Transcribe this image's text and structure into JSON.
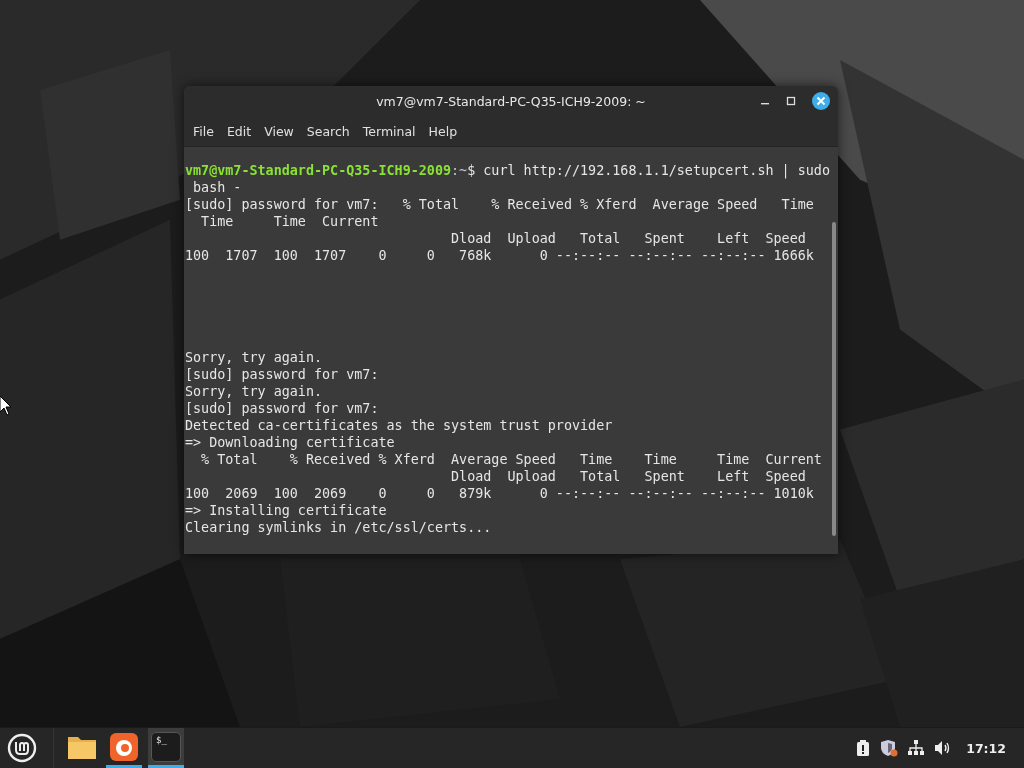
{
  "window": {
    "title": "vm7@vm7-Standard-PC-Q35-ICH9-2009: ~",
    "menu": [
      "File",
      "Edit",
      "View",
      "Search",
      "Terminal",
      "Help"
    ]
  },
  "terminal": {
    "blocks": [
      [
        {
          "kind": "prompt",
          "user_host": "vm7@vm7-Standard-PC-Q35-ICH9-2009",
          "path": ":~",
          "text": "$ curl http://192.168.1.1/setupcert.sh | sudo"
        },
        {
          "kind": "output",
          "text": " bash -"
        },
        {
          "kind": "output",
          "text": "[sudo] password for vm7:   % Total    % Received % Xferd  Average Speed   Time"
        },
        {
          "kind": "output",
          "text": "  Time     Time  Current"
        },
        {
          "kind": "output",
          "text": "                                 Dload  Upload   Total   Spent    Left  Speed"
        },
        {
          "kind": "output",
          "text": "100  1707  100  1707    0     0   768k      0 --:--:-- --:--:-- --:--:-- 1666k"
        }
      ],
      [
        {
          "kind": "output",
          "text": "Sorry, try again."
        },
        {
          "kind": "output",
          "text": "[sudo] password for vm7:"
        },
        {
          "kind": "output",
          "text": "Sorry, try again."
        },
        {
          "kind": "output",
          "text": "[sudo] password for vm7:"
        },
        {
          "kind": "output",
          "text": "Detected ca-certificates as the system trust provider"
        },
        {
          "kind": "output",
          "text": "=> Downloading certificate"
        },
        {
          "kind": "output",
          "text": "  % Total    % Received % Xferd  Average Speed   Time    Time     Time  Current"
        },
        {
          "kind": "output",
          "text": "                                 Dload  Upload   Total   Spent    Left  Speed"
        },
        {
          "kind": "output",
          "text": "100  2069  100  2069    0     0   879k      0 --:--:-- --:--:-- --:--:-- 1010k"
        },
        {
          "kind": "output",
          "text": "=> Installing certificate"
        },
        {
          "kind": "output",
          "text": "Clearing symlinks in /etc/ssl/certs..."
        }
      ]
    ]
  },
  "taskbar": {
    "apps": [
      {
        "kind": "files",
        "running": false,
        "selected": false
      },
      {
        "kind": "browser",
        "running": true,
        "selected": false
      },
      {
        "kind": "terminal",
        "label": "$_",
        "running": true,
        "selected": true
      }
    ],
    "clock": "17:12"
  }
}
